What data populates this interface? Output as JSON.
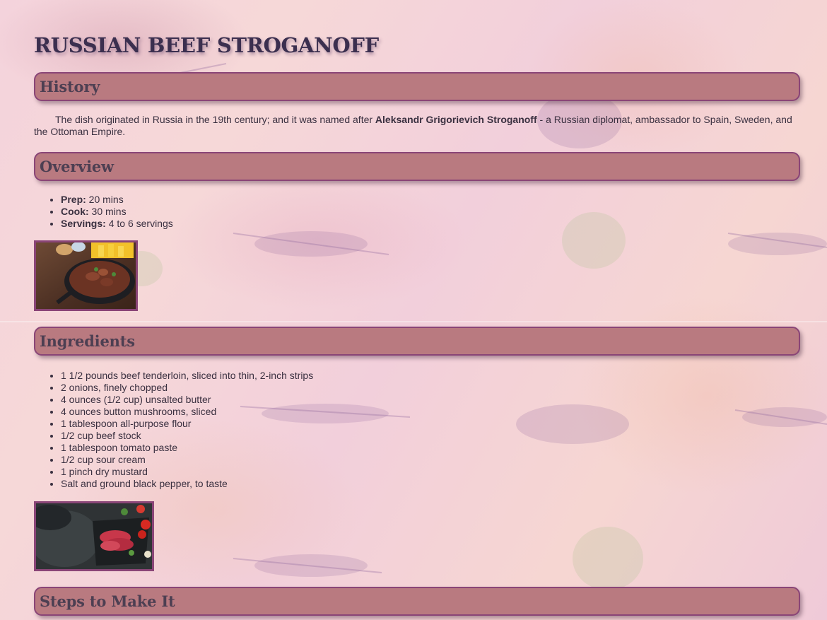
{
  "page": {
    "title": "RUSSIAN BEEF STROGANOFF"
  },
  "history": {
    "heading": "History",
    "text_before": "The dish originated in Russia in the 19th century; and it was named after ",
    "text_bold": "Aleksandr Grigorievich Stroganoff",
    "text_after": " - a Russian diplomat, ambassador to Spain, Sweden, and the Ottoman Empire."
  },
  "overview": {
    "heading": "Overview",
    "items": [
      {
        "label": "Prep:",
        "value": " 20 mins"
      },
      {
        "label": "Cook:",
        "value": " 30 mins"
      },
      {
        "label": "Servings:",
        "value": " 4 to 6 servings"
      }
    ]
  },
  "ingredients": {
    "heading": "Ingredients",
    "items": [
      "1 1/2 pounds beef tenderloin, sliced into thin, 2-inch strips",
      "2 onions, finely chopped",
      "4 ounces (1/2 cup) unsalted butter",
      "4 ounces button mushrooms, sliced",
      "1 tablespoon all-purpose flour",
      "1/2 cup beef stock",
      "1 tablespoon tomato paste",
      "1/2 cup sour cream",
      "1 pinch dry mustard",
      "Salt and ground black pepper, to taste"
    ]
  },
  "steps": {
    "heading": "Steps to Make It"
  },
  "colors": {
    "header_fill": "#b97a80",
    "header_border": "#8a4577",
    "title": "#3b2f4f"
  }
}
